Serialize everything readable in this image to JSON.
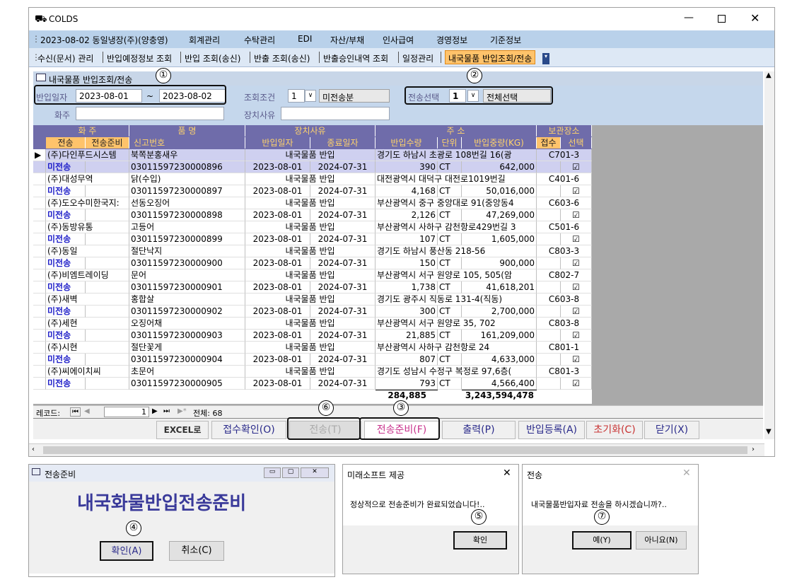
{
  "app": {
    "title": "COLDS"
  },
  "menu": {
    "items": [
      "2023-08-02 동일냉장(주)(양충영)",
      "회계관리",
      "수탁관리",
      "EDI",
      "자산/부채",
      "인사급여",
      "경영정보",
      "기준정보"
    ]
  },
  "toolbar": {
    "items": [
      "수신(문서) 관리",
      "반입예정정보 조회",
      "반입 조회(송신)",
      "반출 조회(송신)",
      "반출승인내역 조회",
      "일정관리"
    ],
    "active": "내국물품 반입조회/전송"
  },
  "child": {
    "title": "내국물품 반입조회/전송"
  },
  "form": {
    "date_label": "반입일자",
    "date_from": "2023-08-01",
    "tilde": "~",
    "date_to": "2023-08-02",
    "query_label": "조회조건",
    "query_value": "1",
    "query_text": "미전송분",
    "send_label": "전송선택",
    "send_value": "1",
    "send_text": "전체선택",
    "owner_label": "화주",
    "reason_label": "장치사유"
  },
  "headers": {
    "r1": [
      "화   주",
      "품   명",
      "장치사유",
      "주   소",
      "보관장소"
    ],
    "r2": [
      "전송",
      "전송준비",
      "신고번호",
      "반입일자",
      "종료일자",
      "반입수량",
      "단위",
      "반입중량(KG)",
      "접수",
      "선택"
    ]
  },
  "rows": [
    {
      "company": "(주)다인푸드시스템",
      "item": "북쪽분홍새우",
      "reason": "내국물품 반입",
      "address": "경기도 하남시 초광로 108번길 16(광",
      "loc": "C701-3",
      "status": "미전송",
      "decl": "03011597230000896",
      "indate": "2023-08-01",
      "enddate": "2024-07-31",
      "qty": "390",
      "unit": "CT",
      "weight": "642,000",
      "check": "☑"
    },
    {
      "company": "(주)대성무역",
      "item": "닭(수입)",
      "reason": "내국물품 반입",
      "address": "대전광역시 대덕구 대전로1019번길",
      "loc": "C401-6",
      "status": "미전송",
      "decl": "03011597230000897",
      "indate": "2023-08-01",
      "enddate": "2024-07-31",
      "qty": "4,168",
      "unit": "CT",
      "weight": "50,016,000",
      "check": "☑"
    },
    {
      "company": "(주)도오수미한국지:",
      "item": "선동오징어",
      "reason": "내국물품 반입",
      "address": "부산광역시 중구 중앙대로 91(중앙동4",
      "loc": "C603-6",
      "status": "미전송",
      "decl": "03011597230000898",
      "indate": "2023-08-01",
      "enddate": "2024-07-31",
      "qty": "2,126",
      "unit": "CT",
      "weight": "47,269,000",
      "check": "☑"
    },
    {
      "company": "(주)동방유통",
      "item": "고등어",
      "reason": "내국물품 반입",
      "address": "부산광역시 사하구 감천항로429번길 3",
      "loc": "C501-6",
      "status": "미전송",
      "decl": "03011597230000899",
      "indate": "2023-08-01",
      "enddate": "2024-07-31",
      "qty": "107",
      "unit": "CT",
      "weight": "1,605,000",
      "check": "☑"
    },
    {
      "company": "(주)동일",
      "item": "절단낙지",
      "reason": "내국물품 반입",
      "address": "경기도 하남시 풍산동 218-56",
      "loc": "C803-3",
      "status": "미전송",
      "decl": "03011597230000900",
      "indate": "2023-08-01",
      "enddate": "2024-07-31",
      "qty": "150",
      "unit": "CT",
      "weight": "900,000",
      "check": "☑"
    },
    {
      "company": "(주)비엠트레이딩",
      "item": "문어",
      "reason": "내국물품 반입",
      "address": "부산광역시 서구 원양로 105, 505(암",
      "loc": "C802-7",
      "status": "미전송",
      "decl": "03011597230000901",
      "indate": "2023-08-01",
      "enddate": "2024-07-31",
      "qty": "1,738",
      "unit": "CT",
      "weight": "41,618,201",
      "check": "☑"
    },
    {
      "company": "(주)새벽",
      "item": "홍합살",
      "reason": "내국물품 반입",
      "address": "경기도 광주시 직동로 131-4(직동)",
      "loc": "C603-8",
      "status": "미전송",
      "decl": "03011597230000902",
      "indate": "2023-08-01",
      "enddate": "2024-07-31",
      "qty": "300",
      "unit": "CT",
      "weight": "2,700,000",
      "check": "☑"
    },
    {
      "company": "(주)세현",
      "item": "오징어채",
      "reason": "내국물품 반입",
      "address": "부산광역시 서구 원양로 35, 702",
      "loc": "C803-8",
      "status": "미전송",
      "decl": "03011597230000903",
      "indate": "2023-08-01",
      "enddate": "2024-07-31",
      "qty": "21,885",
      "unit": "CT",
      "weight": "161,209,000",
      "check": "☑"
    },
    {
      "company": "(주)시현",
      "item": "절단꽃게",
      "reason": "내국물품 반입",
      "address": "부산광역시 사하구 감천항로 24",
      "loc": "C801-1",
      "status": "미전송",
      "decl": "03011597230000904",
      "indate": "2023-08-01",
      "enddate": "2024-07-31",
      "qty": "807",
      "unit": "CT",
      "weight": "4,633,000",
      "check": "☑"
    },
    {
      "company": "(주)씨에이치씨",
      "item": "초문어",
      "reason": "내국물품 반입",
      "address": "경기도 성남시 수정구 복정로 97,6층(",
      "loc": "C801-3",
      "status": "미전송",
      "decl": "03011597230000905",
      "indate": "2023-08-01",
      "enddate": "2024-07-31",
      "qty": "793",
      "unit": "CT",
      "weight": "4,566,400",
      "check": "☑"
    }
  ],
  "totals": {
    "qty": "284,885",
    "weight": "3,243,594,478"
  },
  "nav": {
    "label": "레코드:",
    "current": "1",
    "total": "전체: 68"
  },
  "buttons": {
    "excel": "EXCEL로",
    "receive": "접수확인(O)",
    "send": "전송(T)",
    "prep": "전송준비(F)",
    "print": "출력(P)",
    "register": "반입등록(A)",
    "reset": "초기화(C)",
    "close": "닫기(X)"
  },
  "dlg1": {
    "title": "전송준비",
    "heading": "내국화물반입전송준비",
    "ok": "확인(A)",
    "cancel": "취소(C)"
  },
  "dlg2": {
    "title": "미래소프트 제공",
    "message": "정상적으로 전송준비가 완료되었습니다!..",
    "ok": "확인"
  },
  "dlg3": {
    "title": "전송",
    "message": "내국물품반입자료 전송을 하시겠습니까?..",
    "yes": "예(Y)",
    "no": "아니요(N)"
  },
  "callouts": [
    "①",
    "②",
    "③",
    "④",
    "⑤",
    "⑥",
    "⑦"
  ]
}
